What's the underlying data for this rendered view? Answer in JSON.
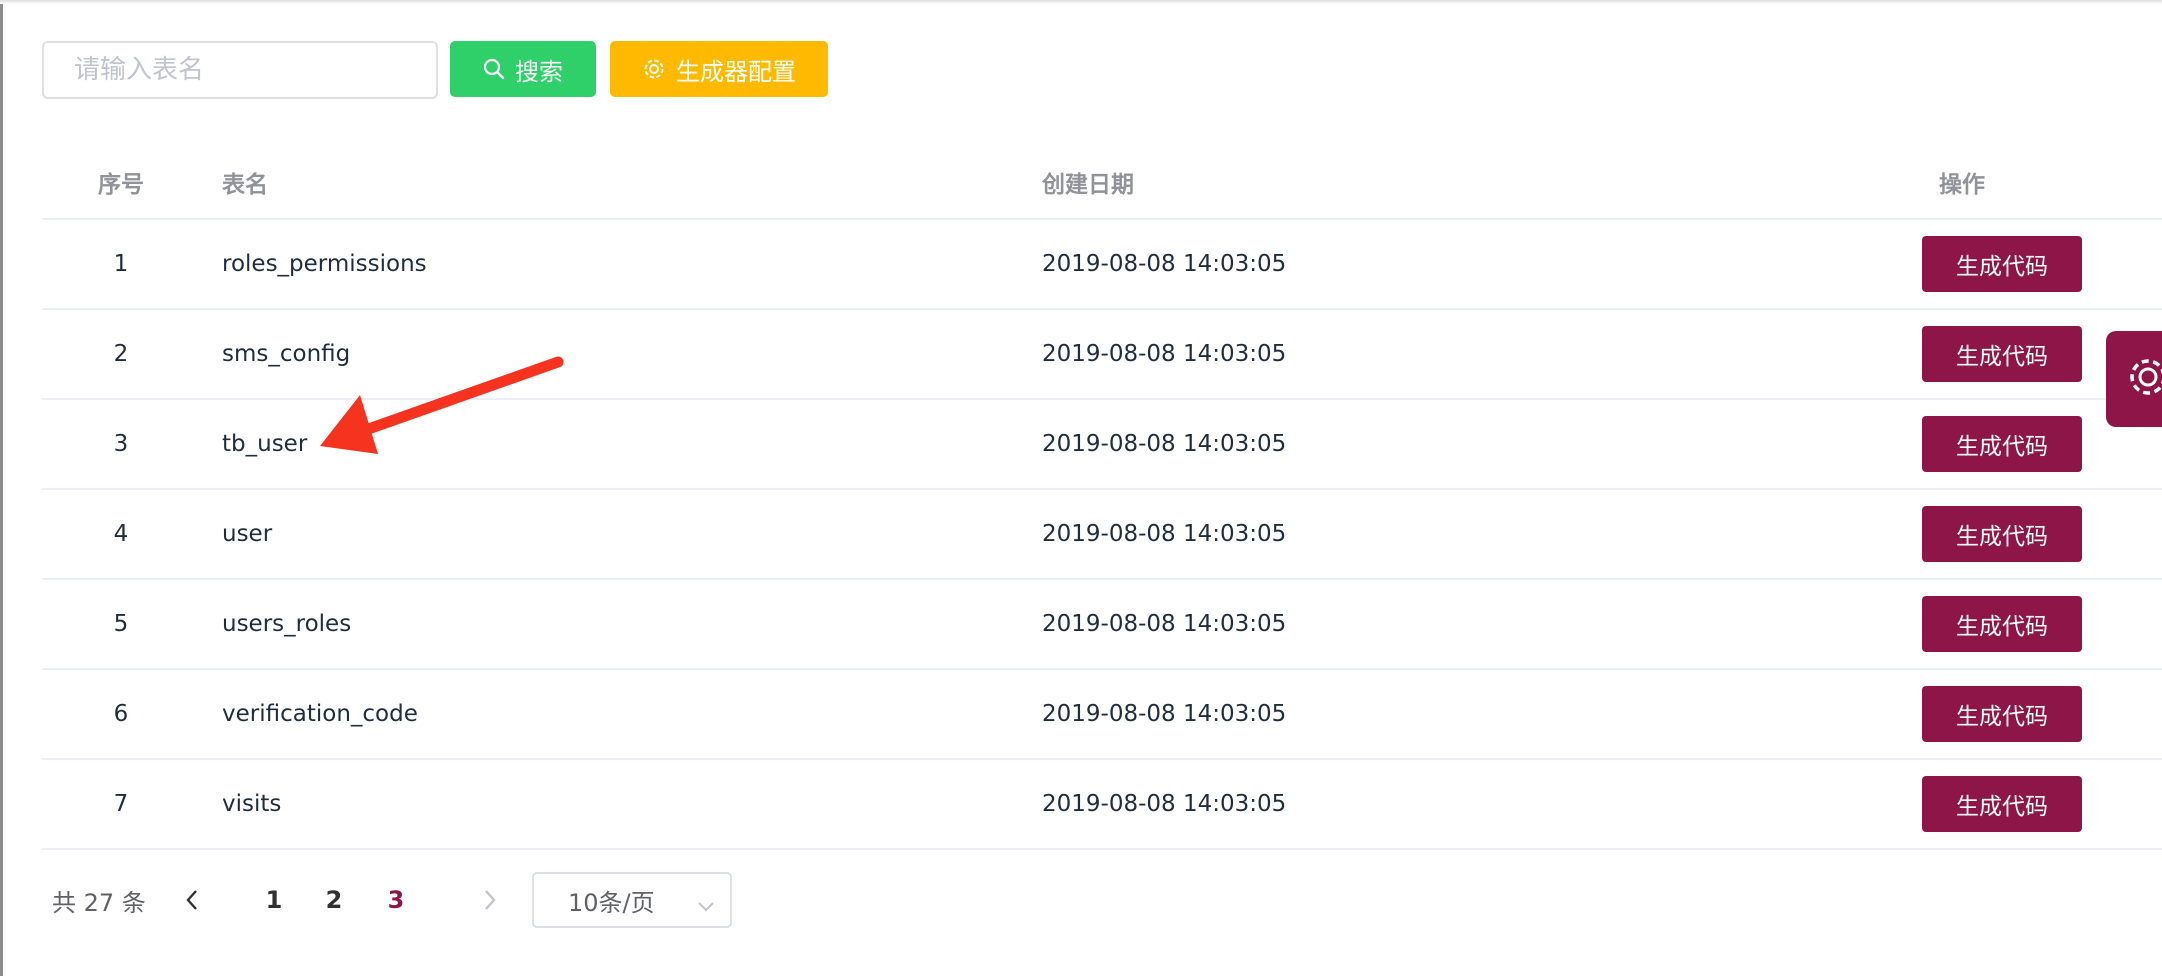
{
  "toolbar": {
    "search_placeholder": "请输入表名",
    "search_button": "搜索",
    "config_button": "生成器配置"
  },
  "table": {
    "headers": {
      "index": "序号",
      "name": "表名",
      "date": "创建日期",
      "actions": "操作"
    },
    "rows": [
      {
        "index": "1",
        "name": "roles_permissions",
        "date": "2019-08-08 14:03:05",
        "action": "生成代码"
      },
      {
        "index": "2",
        "name": "sms_config",
        "date": "2019-08-08 14:03:05",
        "action": "生成代码"
      },
      {
        "index": "3",
        "name": "tb_user",
        "date": "2019-08-08 14:03:05",
        "action": "生成代码"
      },
      {
        "index": "4",
        "name": "user",
        "date": "2019-08-08 14:03:05",
        "action": "生成代码"
      },
      {
        "index": "5",
        "name": "users_roles",
        "date": "2019-08-08 14:03:05",
        "action": "生成代码"
      },
      {
        "index": "6",
        "name": "verification_code",
        "date": "2019-08-08 14:03:05",
        "action": "生成代码"
      },
      {
        "index": "7",
        "name": "visits",
        "date": "2019-08-08 14:03:05",
        "action": "生成代码"
      }
    ]
  },
  "pagination": {
    "total": "共 27 条",
    "pages": [
      "1",
      "2",
      "3"
    ],
    "current_page": "3",
    "page_size": "10条/页"
  },
  "colors": {
    "primary": "#8e1548",
    "search_button": "#2fd06a",
    "config_button": "#ffba00",
    "annotation_arrow": "#f5331f"
  },
  "icons": {
    "search": "search-icon",
    "config": "gear-icon",
    "prev": "chevron-left-icon",
    "next": "chevron-right-icon",
    "dropdown": "chevron-down-icon",
    "floating": "gear-icon"
  }
}
